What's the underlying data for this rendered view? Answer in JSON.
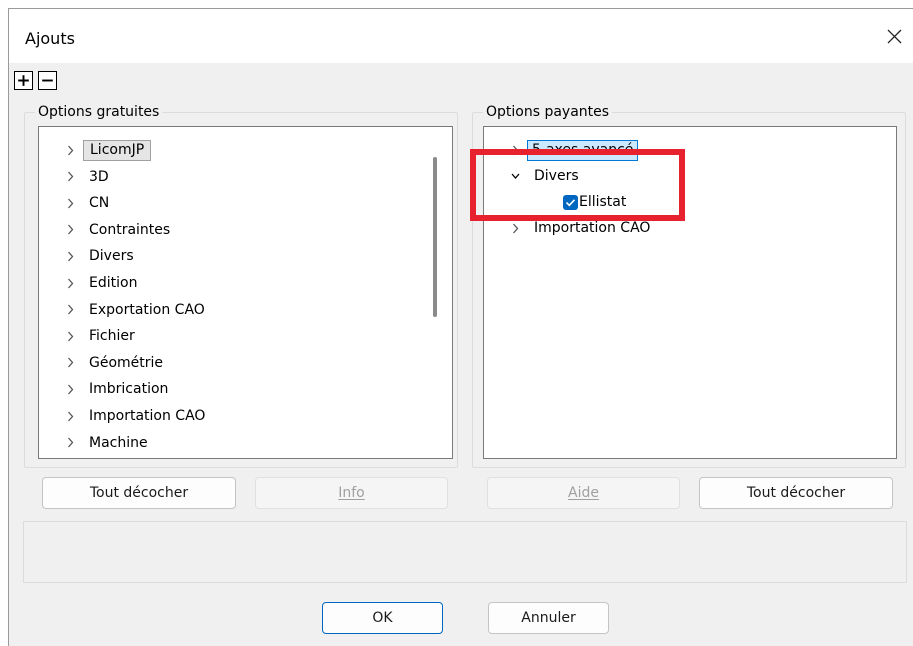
{
  "window": {
    "title": "Ajouts"
  },
  "toolbar": {
    "expand_all": "+",
    "collapse_all": "−"
  },
  "free_options": {
    "label": "Options gratuites",
    "items": [
      {
        "label": "LicomJP",
        "highlighted": true
      },
      {
        "label": "3D"
      },
      {
        "label": "CN"
      },
      {
        "label": "Contraintes"
      },
      {
        "label": "Divers"
      },
      {
        "label": "Edition"
      },
      {
        "label": "Exportation CAO"
      },
      {
        "label": "Fichier"
      },
      {
        "label": "Géométrie"
      },
      {
        "label": "Imbrication"
      },
      {
        "label": "Importation CAO"
      },
      {
        "label": "Machine"
      }
    ]
  },
  "paid_options": {
    "label": "Options payantes",
    "items": [
      {
        "label": "5-axes avancé",
        "selected": true,
        "expanded": false
      },
      {
        "label": "Divers",
        "expanded": true,
        "children": [
          {
            "label": "Ellistat",
            "checked": true
          }
        ]
      },
      {
        "label": "Importation CAO",
        "expanded": false
      }
    ]
  },
  "buttons": {
    "uncheck_all_left": "Tout décocher",
    "info": "Info",
    "help": "Aide",
    "uncheck_all_right": "Tout décocher",
    "ok": "OK",
    "cancel": "Annuler"
  },
  "colors": {
    "accent": "#0067c0",
    "highlight_box": "#e8212e",
    "selection": "#cce8ff"
  }
}
